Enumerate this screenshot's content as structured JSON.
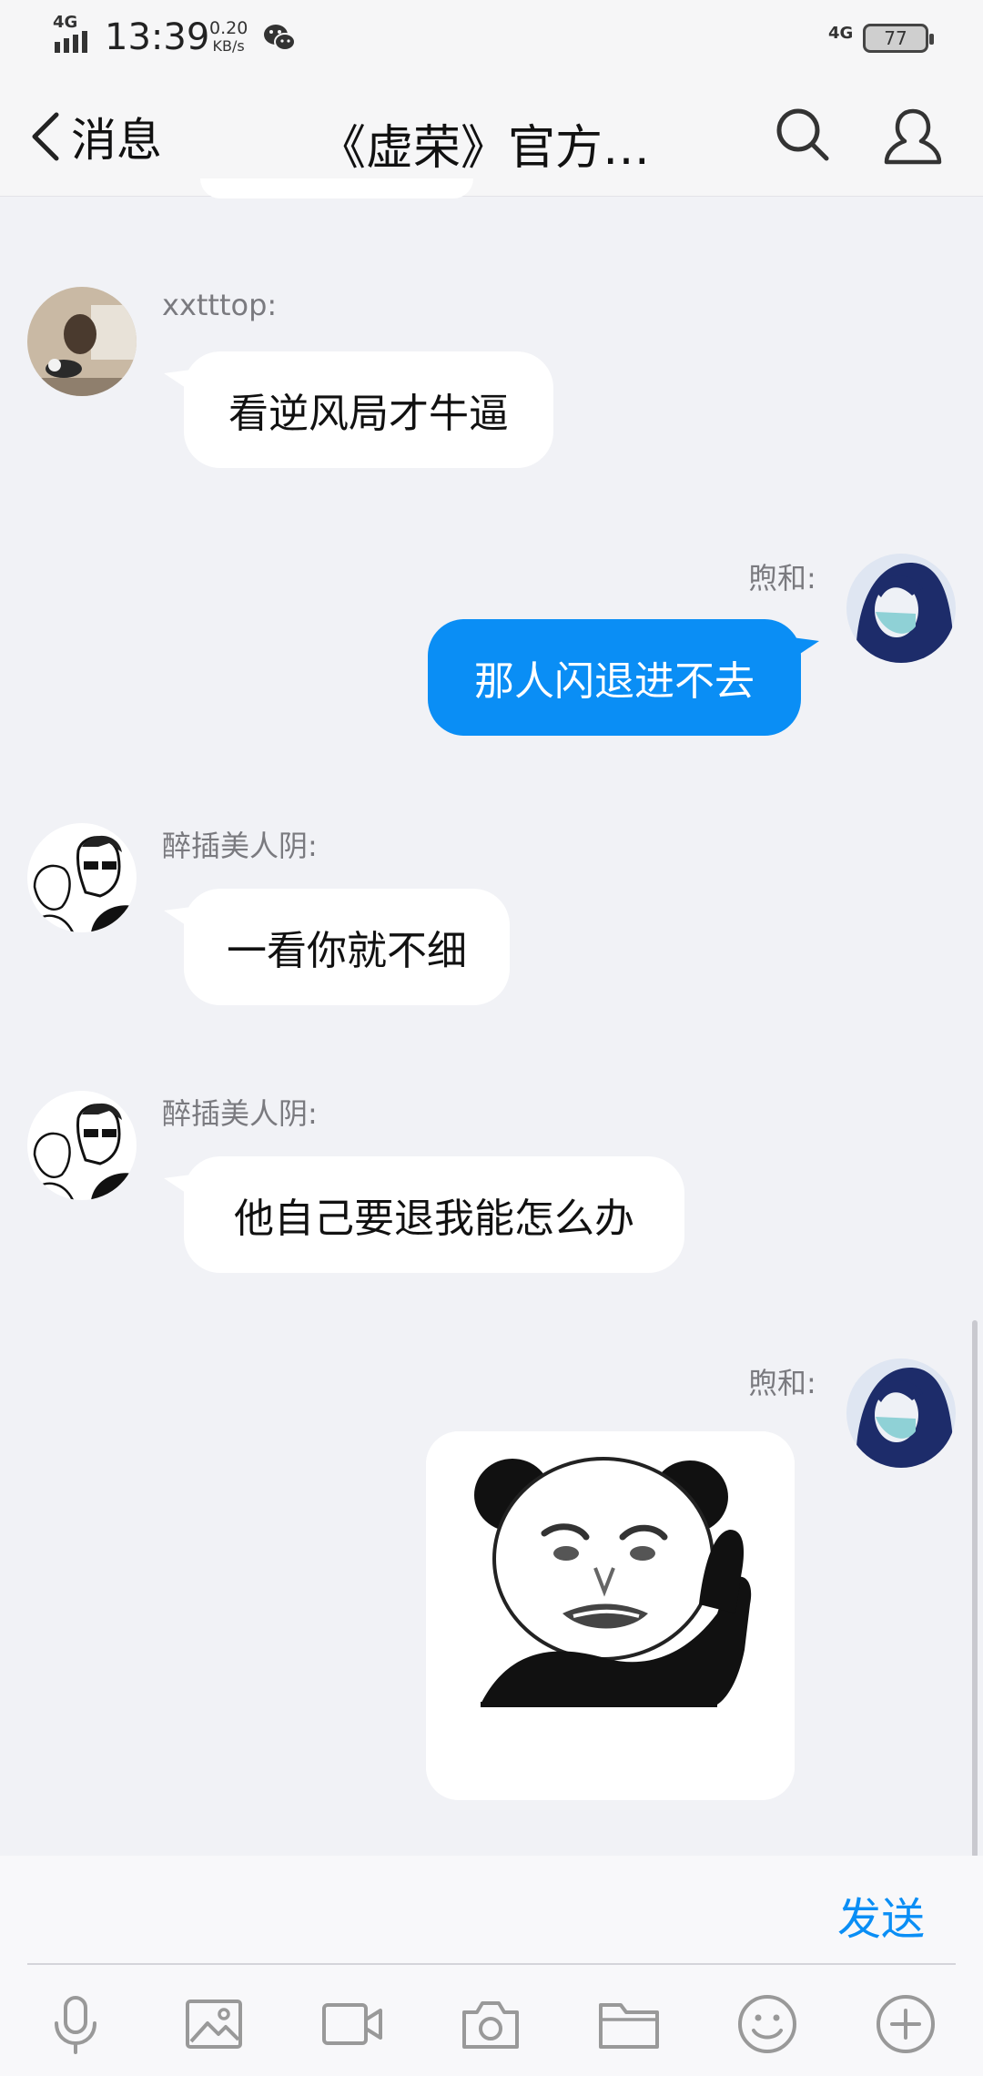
{
  "status_bar": {
    "network_left": "4G",
    "time": "13:39",
    "speed_value": "0.20",
    "speed_unit": "KB/s",
    "network_right": "4G",
    "battery": "77",
    "icons": [
      "signal-icon",
      "wechat-icon",
      "battery-icon"
    ]
  },
  "nav": {
    "back_label": "消息",
    "title": "《虚荣》官方…",
    "icons": [
      "back-chevron-icon",
      "search-icon",
      "profile-icon"
    ]
  },
  "messages": [
    {
      "sender": "xxtttop:",
      "text": "看逆风局才牛逼",
      "direction": "incoming"
    },
    {
      "sender": "煦和:",
      "text": "那人闪退进不去",
      "direction": "outgoing"
    },
    {
      "sender": "醉插美人阴:",
      "text": "一看你就不细",
      "direction": "incoming"
    },
    {
      "sender": "醉插美人阴:",
      "text": "他自己要退我能怎么办",
      "direction": "incoming"
    },
    {
      "sender": "煦和:",
      "text": "",
      "direction": "outgoing",
      "sticker": "panda-meme-sticker"
    }
  ],
  "input": {
    "placeholder": "",
    "value": "",
    "send_label": "发送"
  },
  "toolbar": [
    "microphone-icon",
    "image-icon",
    "video-icon",
    "camera-icon",
    "folder-icon",
    "emoji-icon",
    "plus-icon"
  ],
  "colors": {
    "accent": "#0a8ef5",
    "background": "#f1f2f6",
    "bubble_incoming": "#ffffff",
    "bubble_outgoing": "#0a8ef5"
  }
}
